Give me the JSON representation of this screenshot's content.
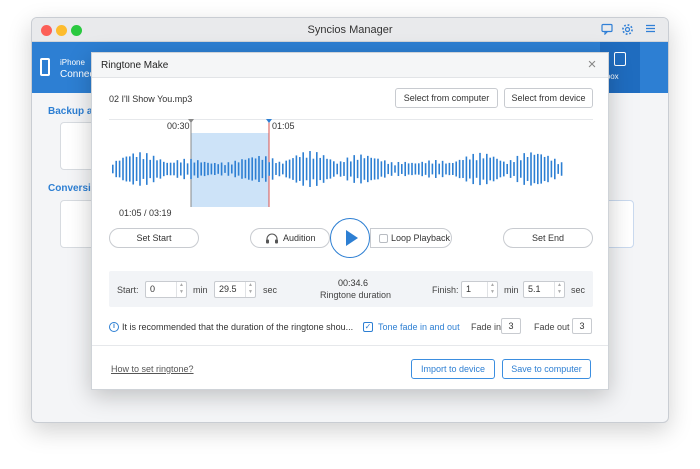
{
  "window": {
    "title": "Syncios Manager"
  },
  "device": {
    "name": "iPhone",
    "status": "Connect"
  },
  "main": {
    "backup_title": "Backup an",
    "conversion_title": "Conversion",
    "toolbox_label": "lbox"
  },
  "icons": {
    "titlebar": [
      "chat-icon",
      "gear-icon",
      "menu-icon"
    ]
  },
  "colors": {
    "accent": "#2d7fd3",
    "selection": "#cde3f8",
    "end_marker": "#d9534f"
  },
  "modal": {
    "title": "Ringtone Make",
    "close": "×",
    "filename": "02 I'll Show You.mp3",
    "select_computer": "Select from computer",
    "select_device": "Select from device",
    "sel_start_label": "00:30",
    "sel_end_label": "01:05",
    "position": "01:05 / 03:19",
    "set_start": "Set Start",
    "audition": "Audition",
    "loop_playback": "Loop Playback",
    "set_end": "Set End",
    "start_label": "Start:",
    "start_min": "0",
    "start_sec": "29.5",
    "min_label": "min",
    "sec_label": "sec",
    "duration_value": "00:34.6",
    "duration_label": "Ringtone duration",
    "finish_label": "Finish:",
    "finish_min": "1",
    "finish_sec": "5.1",
    "recommend_text": "It is recommended that the duration of the ringtone shou...",
    "tone_fade": "Tone fade in and out",
    "fade_in_label": "Fade in",
    "fade_in_value": "3",
    "fade_out_label": "Fade out",
    "fade_out_value": "3",
    "how_to": "How to set ringtone?",
    "import_device": "Import to device",
    "save_computer": "Save to computer"
  }
}
